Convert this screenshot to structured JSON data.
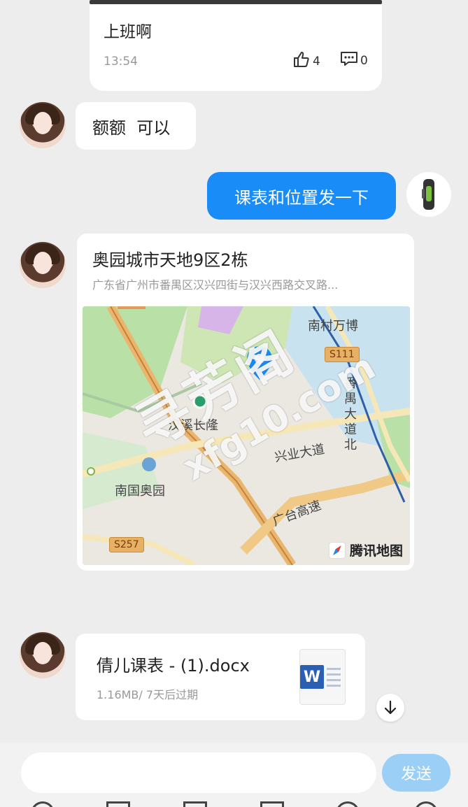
{
  "post": {
    "title": "上班啊",
    "time": "13:54",
    "likes": "4",
    "comments": "0"
  },
  "messages": {
    "m1_text": "额额  可以",
    "m2_text": "课表和位置发一下"
  },
  "location": {
    "name": "奥园城市天地9区2栋",
    "address": "广东省广州市番禺区汉兴四街与汉兴西路交叉路...",
    "map_labels": {
      "nancun": "南村万博",
      "s111": "S111",
      "panyu_road": "番禺大道北",
      "hanxi": "汉溪长隆",
      "xingye": "兴业大道",
      "nanguo": "南国奥园",
      "guangtai": "广台高速",
      "s257": "S257"
    },
    "map_brand": "腾讯地图"
  },
  "file": {
    "name": "倩儿课表 - (1).docx",
    "meta": "1.16MB/ 7天后过期",
    "icon_letter": "W"
  },
  "composer": {
    "placeholder": "",
    "send_label": "发送"
  },
  "watermark": {
    "line1": "寻芳阁",
    "line2": "xfg10.com"
  },
  "colors": {
    "accent_blue": "#1a8cf7",
    "send_disabled": "#9ccff6",
    "background": "#ededed"
  }
}
